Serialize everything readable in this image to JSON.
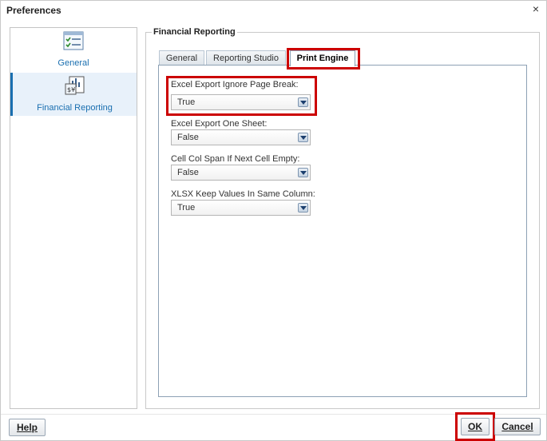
{
  "dialog": {
    "title": "Preferences",
    "close_symbol": "×"
  },
  "nav": {
    "items": [
      {
        "label": "General",
        "icon": "checklist-icon",
        "selected": false
      },
      {
        "label": "Financial Reporting",
        "icon": "report-icon",
        "selected": true
      }
    ]
  },
  "group": {
    "legend": "Financial Reporting"
  },
  "tabs": [
    {
      "label": "General",
      "active": false
    },
    {
      "label": "Reporting Studio",
      "active": false
    },
    {
      "label": "Print Engine",
      "active": true
    }
  ],
  "fields": [
    {
      "label": "Excel Export Ignore Page Break:",
      "value": "True"
    },
    {
      "label": "Excel Export One Sheet:",
      "value": "False"
    },
    {
      "label": "Cell Col Span If Next Cell Empty:",
      "value": "False"
    },
    {
      "label": "XLSX Keep Values In Same Column:",
      "value": "True"
    }
  ],
  "buttons": {
    "help": "Help",
    "ok": "OK",
    "cancel": "Cancel"
  },
  "colors": {
    "accent": "#1a6fb0",
    "highlight": "#cc0000"
  }
}
